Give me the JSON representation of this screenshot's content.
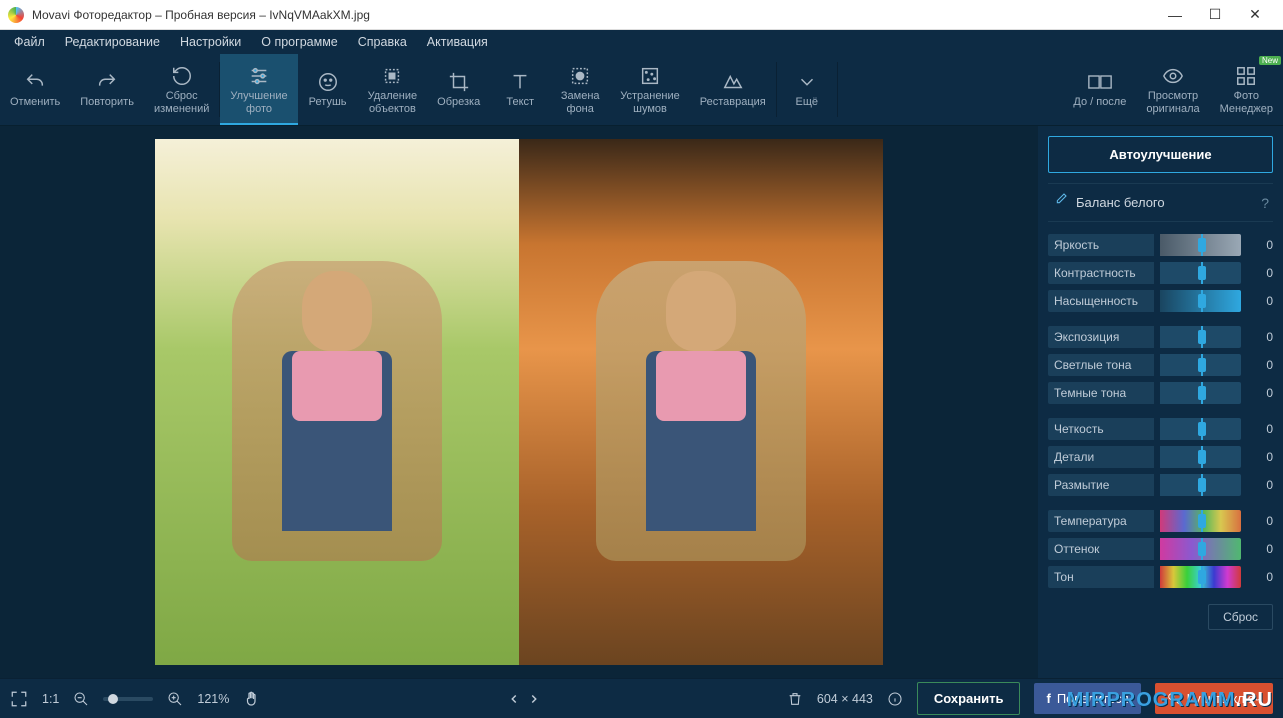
{
  "window": {
    "title": "Movavi Фоторедактор – Пробная версия – IvNqVMAakXM.jpg"
  },
  "menu": {
    "file": "Файл",
    "edit": "Редактирование",
    "settings": "Настройки",
    "about": "О программе",
    "help": "Справка",
    "activation": "Активация"
  },
  "toolbar": {
    "undo": "Отменить",
    "redo": "Повторить",
    "reset": "Сброс\nизменений",
    "enhance": "Улучшение\nфото",
    "retouch": "Ретушь",
    "remove": "Удаление\nобъектов",
    "crop": "Обрезка",
    "text": "Текст",
    "bg": "Замена\nфона",
    "noise": "Устранение\nшумов",
    "restore": "Реставрация",
    "more": "Ещё",
    "before_after": "До / после",
    "original": "Просмотр\nоригинала",
    "manager": "Фото\nМенеджер",
    "new_badge": "New"
  },
  "panel": {
    "auto": "Автоулучшение",
    "wb": "Баланс белого",
    "help": "?",
    "reset": "Сброс",
    "sliders": {
      "brightness": {
        "label": "Яркость",
        "value": 0
      },
      "contrast": {
        "label": "Контрастность",
        "value": 0
      },
      "saturation": {
        "label": "Насыщенность",
        "value": 0
      },
      "exposure": {
        "label": "Экспозиция",
        "value": 0
      },
      "highlights": {
        "label": "Светлые тона",
        "value": 0
      },
      "shadows": {
        "label": "Темные тона",
        "value": 0
      },
      "sharpness": {
        "label": "Четкость",
        "value": 0
      },
      "details": {
        "label": "Детали",
        "value": 0
      },
      "blur": {
        "label": "Размытие",
        "value": 0
      },
      "temperature": {
        "label": "Температура",
        "value": 0
      },
      "tint": {
        "label": "Оттенок",
        "value": 0
      },
      "hue": {
        "label": "Тон",
        "value": 0
      }
    }
  },
  "status": {
    "ratio": "1:1",
    "zoom": "121%",
    "dimensions": "604 × 443",
    "save": "Сохранить",
    "share": "Поделиться",
    "buy": "Купить ключ"
  },
  "watermark": {
    "text1": "MIRPROGRAMM",
    "text2": ".RU"
  }
}
